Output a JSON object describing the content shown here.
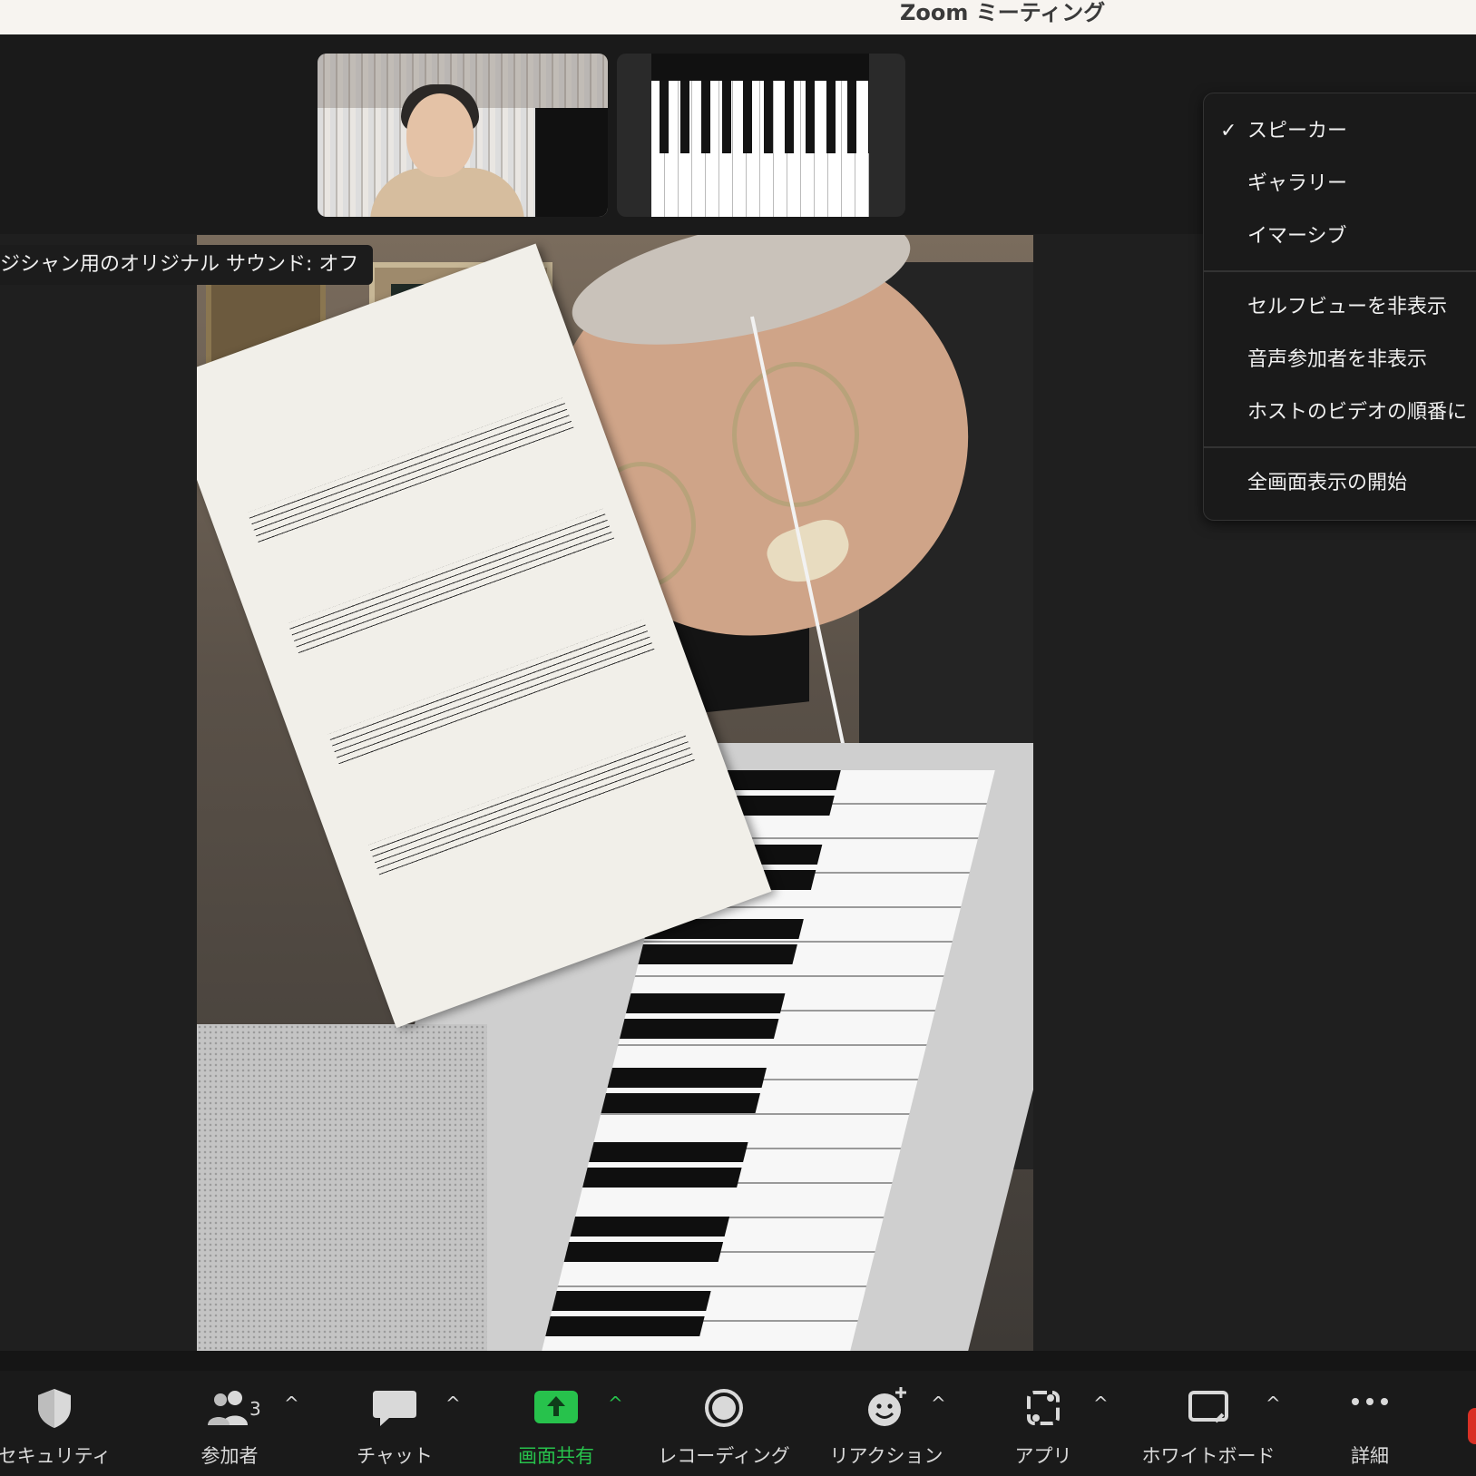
{
  "window": {
    "title": "Zoom ミーティング"
  },
  "banner": {
    "text": "ジシャン用のオリジナル サウンド: オフ"
  },
  "view_menu": {
    "items": [
      {
        "label": "スピーカー",
        "checked": true
      },
      {
        "label": "ギャラリー",
        "checked": false
      },
      {
        "label": "イマーシブ",
        "checked": false
      },
      {
        "label": "セルフビューを非表示",
        "checked": false
      },
      {
        "label": "音声参加者を非表示",
        "checked": false
      },
      {
        "label": "ホストのビデオの順番に",
        "checked": false
      },
      {
        "label": "全画面表示の開始",
        "checked": false
      }
    ],
    "check_glyph": "✓"
  },
  "toolbar": {
    "security": {
      "label": "セキュリティ",
      "icon": "shield-icon"
    },
    "participants": {
      "label": "参加者",
      "icon": "people-icon",
      "count": "3"
    },
    "chat": {
      "label": "チャット",
      "icon": "chat-bubble-icon"
    },
    "share": {
      "label": "画面共有",
      "icon": "share-arrow-icon",
      "color": "#27c24c"
    },
    "record": {
      "label": "レコーディング",
      "icon": "record-icon"
    },
    "reactions": {
      "label": "リアクション",
      "icon": "emoji-add-icon"
    },
    "apps": {
      "label": "アプリ",
      "icon": "apps-icon"
    },
    "whiteboard": {
      "label": "ホワイトボード",
      "icon": "whiteboard-icon"
    },
    "more": {
      "label": "詳細",
      "icon": "more-dots-icon"
    },
    "caret_glyph": "^"
  }
}
